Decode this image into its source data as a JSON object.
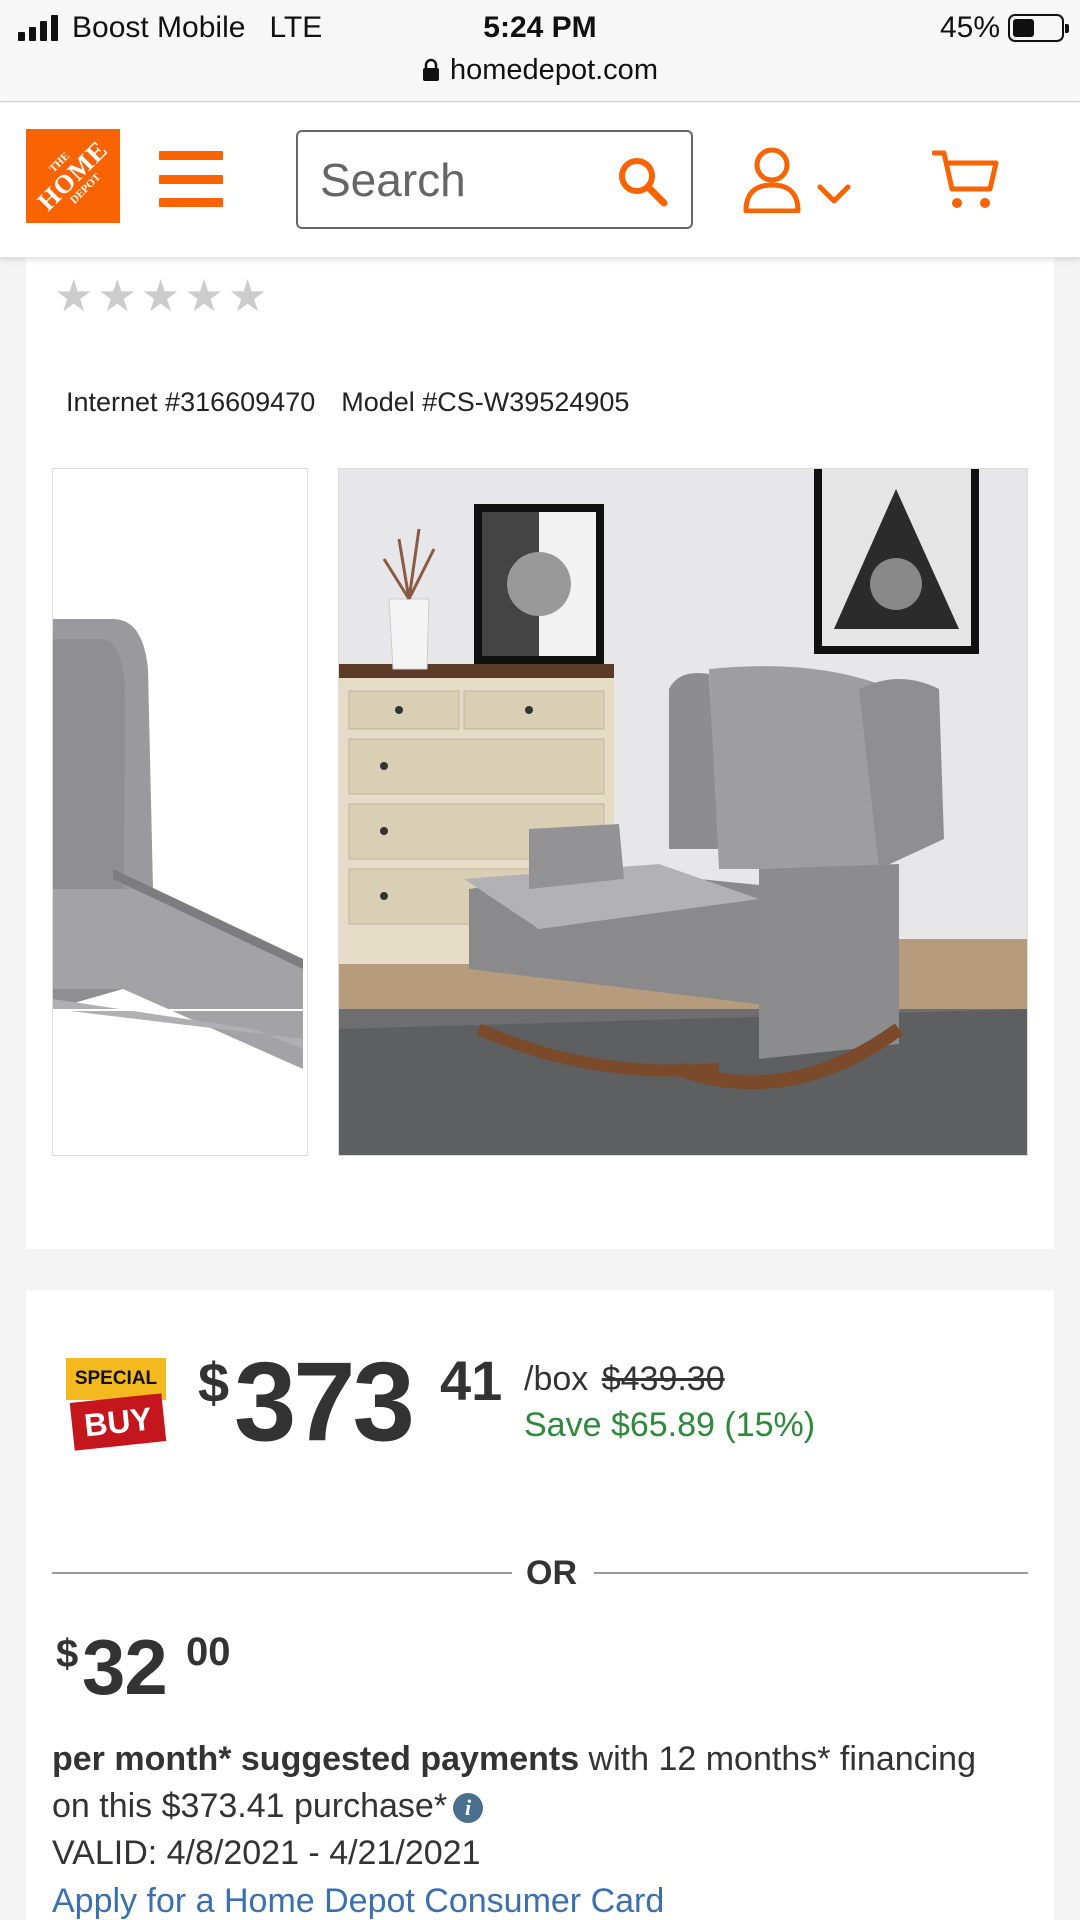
{
  "status_bar": {
    "carrier": "Boost Mobile",
    "network": "LTE",
    "time": "5:24 PM",
    "battery_percent": "45%",
    "battery_level": 0.45,
    "url": "homedepot.com"
  },
  "header": {
    "logo_text_top": "THE",
    "logo_text_mid": "HOME",
    "logo_text_bottom": "DEPOT",
    "search_placeholder": "Search"
  },
  "product": {
    "rating_stars": 0,
    "internet_number": "Internet #316609470",
    "model_number": "Model #CS-W39524905"
  },
  "pricing": {
    "badge_top": "SPECIAL",
    "badge_bottom": "BUY",
    "currency": "$",
    "price_dollars": "373",
    "price_cents": "41",
    "unit": "/box",
    "was_price": "$439.30",
    "savings": "Save $65.89 (15%)",
    "or_label": "OR",
    "monthly_currency": "$",
    "monthly_dollars": "32",
    "monthly_cents": "00",
    "financing_bold": "per month* suggested payments",
    "financing_rest": " with 12 months* financing on this $373.41 purchase*",
    "valid": "VALID: 4/8/2021 - 4/21/2021",
    "apply_link": "Apply for a Home Depot Consumer Card"
  },
  "colors": {
    "brand_orange": "#f96302",
    "savings_green": "#2c8a3a",
    "link_blue": "#3a6fb0",
    "badge_red": "#c4161c",
    "badge_yellow": "#f5b920"
  }
}
